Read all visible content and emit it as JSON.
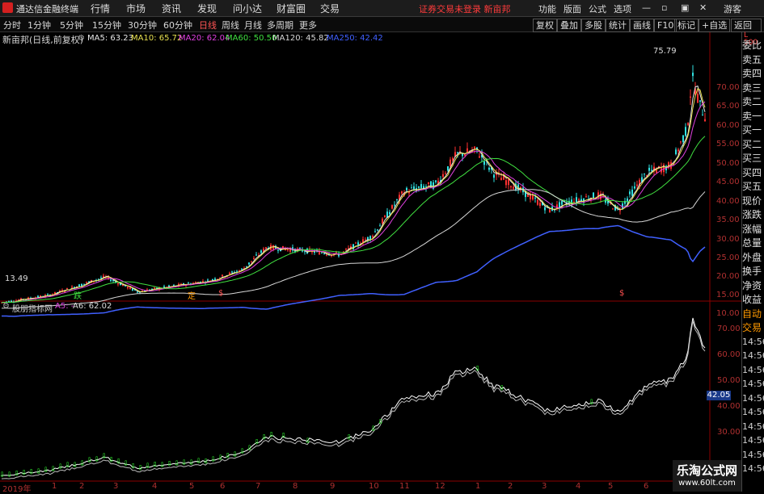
{
  "app": {
    "title": "通达信金融终端"
  },
  "menu": [
    "行情",
    "市场",
    "资讯",
    "发现",
    "问小达",
    "财富圈",
    "交易"
  ],
  "warning": "证券交易未登录 新亩邦",
  "right_menu": [
    "功能",
    "版面",
    "公式",
    "选项",
    "游客"
  ],
  "periods": [
    "分时",
    "1分钟",
    "5分钟",
    "15分钟",
    "30分钟",
    "60分钟",
    "日线",
    "周线",
    "月线",
    "多周期",
    "更多"
  ],
  "active_period": "日线",
  "tools": [
    "复权",
    "叠加",
    "多股",
    "统计",
    "画线",
    "F10",
    "标记",
    "+自选",
    "返回"
  ],
  "stock_name": "新亩邦(日线,前复权)",
  "ma": [
    {
      "label": "MA5: 63.23",
      "color": "#e8e8e8"
    },
    {
      "label": "MA10: 65.72",
      "color": "#e8e050"
    },
    {
      "label": "MA20: 62.04",
      "color": "#e040e0"
    },
    {
      "label": "MA60: 50.50",
      "color": "#40e040"
    },
    {
      "label": "MA120: 45.82",
      "color": "#d8d8d8"
    },
    {
      "label": "MA250: 42.42",
      "color": "#4060ff"
    }
  ],
  "price_labels": [
    "70.00",
    "65.00",
    "60.00",
    "55.00",
    "50.00",
    "45.00",
    "40.00",
    "35.00",
    "30.00",
    "25.00",
    "20.00",
    "15.00",
    "10.00"
  ],
  "high_label": "75.79",
  "low_label": "13.49",
  "markers": [
    "跌",
    "定",
    "$",
    "$"
  ],
  "sub": {
    "title": "股朋指标网",
    "a5": "A5: -",
    "a6": "A6: 62.02",
    "labels": [
      "70.00",
      "60.00",
      "50.00",
      "40.00",
      "30.00"
    ],
    "current": "42.05"
  },
  "right_panel": [
    "委比",
    "卖五",
    "卖四",
    "卖三",
    "卖二",
    "卖一",
    "买一",
    "买二",
    "买三",
    "买四",
    "买五",
    "现价",
    "涨跌",
    "涨幅",
    "总量",
    "外盘",
    "换手",
    "净资",
    "收益",
    "自动",
    "交易",
    "14:56",
    "14:56",
    "14:56",
    "14:56",
    "14:56",
    "14:56",
    "14:56",
    "14:56",
    "14:56",
    "14:56"
  ],
  "x_labels": [
    "2019年",
    "1",
    "2",
    "3",
    "4",
    "5",
    "6",
    "7",
    "8",
    "9",
    "10",
    "11",
    "12",
    "1",
    "2",
    "3",
    "4",
    "5",
    "6"
  ],
  "watermark": {
    "line1": "乐淘公式网",
    "line2": "www.60lt.com"
  },
  "colors": {
    "up": "#ff3030",
    "down": "#30e0e0",
    "accent": "#ff5555"
  }
}
